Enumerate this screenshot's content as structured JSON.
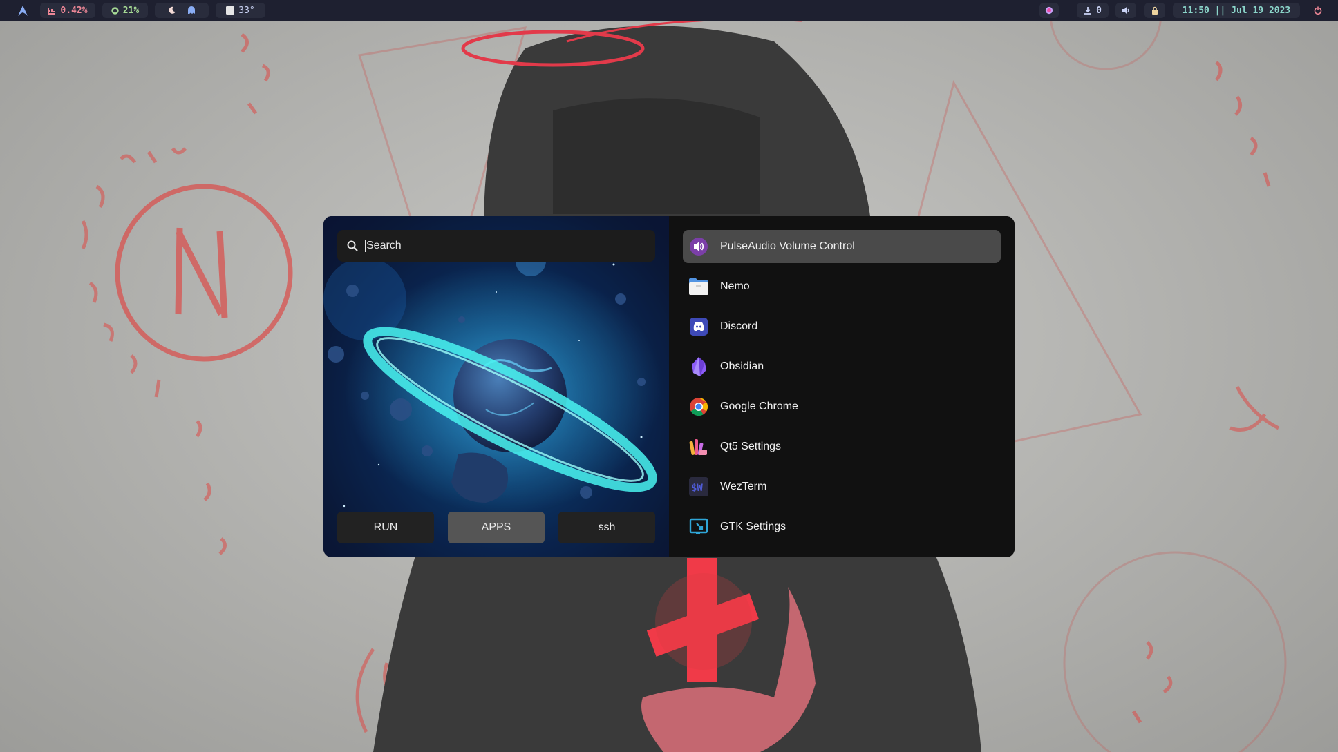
{
  "topbar": {
    "launcher_icon": "arch-logo-icon",
    "cpu": "0.42%",
    "memory": "21%",
    "weather": "33°",
    "downloads": "0",
    "clock": "11:50 || Jul 19 2023",
    "colors": {
      "bar": "#1e2030",
      "pill": "#292c3c",
      "cpu": "#ed8796",
      "mem": "#a6da95",
      "clock": "#8bd5ca",
      "power": "#ed8796"
    }
  },
  "launcher": {
    "search": {
      "placeholder": "Search",
      "value": ""
    },
    "modes": [
      {
        "label": "RUN",
        "active": false
      },
      {
        "label": "APPS",
        "active": true
      },
      {
        "label": "ssh",
        "active": false
      }
    ],
    "apps": [
      {
        "label": "PulseAudio Volume Control",
        "icon": "pulseaudio-icon",
        "selected": true
      },
      {
        "label": "Nemo",
        "icon": "folder-icon"
      },
      {
        "label": "Discord",
        "icon": "discord-icon"
      },
      {
        "label": "Obsidian",
        "icon": "obsidian-icon"
      },
      {
        "label": "Google Chrome",
        "icon": "chrome-icon"
      },
      {
        "label": "Qt5 Settings",
        "icon": "qt5-settings-icon"
      },
      {
        "label": "WezTerm",
        "icon": "wezterm-icon"
      },
      {
        "label": "GTK Settings",
        "icon": "gtk-settings-icon"
      }
    ],
    "colors": {
      "panel": "#101010",
      "selected": "#4a4a4a",
      "active_mode": "#555555"
    }
  }
}
